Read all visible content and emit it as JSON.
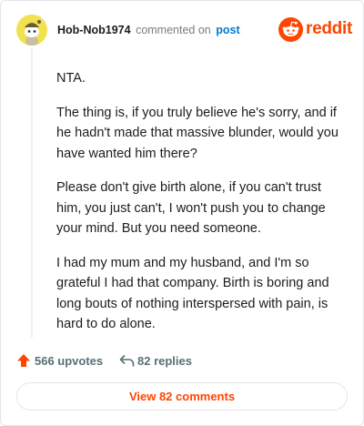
{
  "comment": {
    "author": "Hob-Nob1974",
    "action": "commented on",
    "target": "post",
    "avatar_icon": "snoo-avatar-icon",
    "paragraphs": [
      "NTA.",
      "The thing is, if you truly believe he's sorry, and if he hadn't made that massive blunder, would you have wanted him there?",
      "Please don't give birth alone, if you can't trust him, you just can't, I won't push you to change your mind. But you need someone.",
      "I had my mum and my husband, and I'm so grateful I had that company. Birth is boring and long bouts of nothing interspersed with pain, is hard to do alone."
    ]
  },
  "brand": {
    "name": "reddit",
    "icon": "reddit-logo-icon",
    "color": "#ff4500"
  },
  "footer": {
    "upvotes": "566 upvotes",
    "upvote_icon": "upvote-arrow-icon",
    "replies": "82 replies",
    "reply_icon": "reply-arrow-icon"
  },
  "view_comments_label": "View 82 comments",
  "colors": {
    "accent": "#ff4500",
    "link": "#0079d3",
    "muted": "#7c7c7c",
    "avatar_bg": "#f2e14e"
  }
}
